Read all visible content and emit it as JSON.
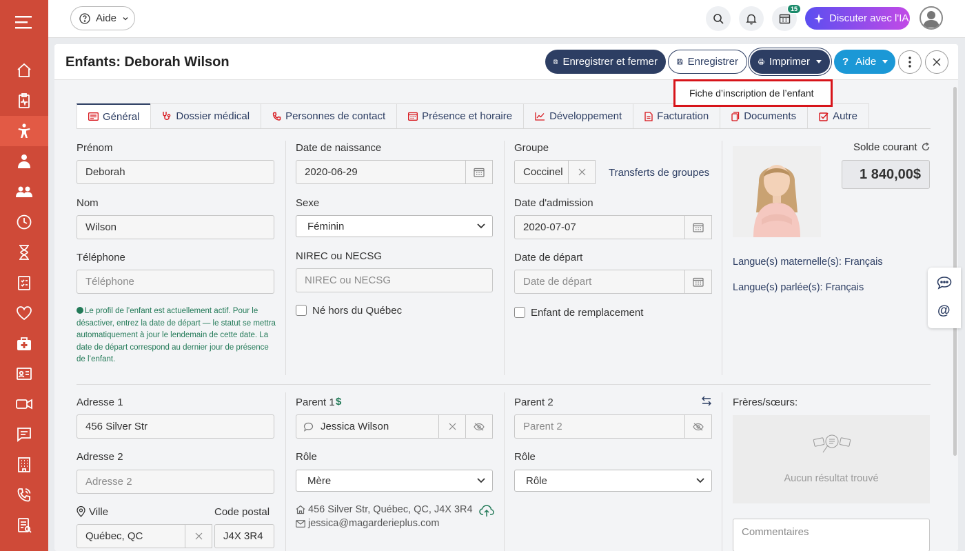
{
  "topbar": {
    "help_label": "Aide",
    "notifications_badge": "15",
    "ai_button_label": "Discuter avec l'IA"
  },
  "header": {
    "title": "Enfants: Deborah Wilson",
    "save_close_label": "Enregistrer et fermer",
    "save_label": "Enregistrer",
    "print_label": "Imprimer",
    "help_label": "Aide"
  },
  "print_menu": {
    "item_label": "Fiche d’inscription de l’enfant"
  },
  "tabs": [
    {
      "label": "Général",
      "icon": "id-card-icon"
    },
    {
      "label": "Dossier médical",
      "icon": "stethoscope-icon"
    },
    {
      "label": "Personnes de contact",
      "icon": "phone-icon"
    },
    {
      "label": "Présence et horaire",
      "icon": "calendar-icon"
    },
    {
      "label": "Développement",
      "icon": "chart-line-icon"
    },
    {
      "label": "Facturation",
      "icon": "invoice-icon"
    },
    {
      "label": "Documents",
      "icon": "document-icon"
    },
    {
      "label": "Autre",
      "icon": "checkbox-icon"
    }
  ],
  "identity": {
    "first_name_label": "Prénom",
    "first_name_value": "Deborah",
    "last_name_label": "Nom",
    "last_name_value": "Wilson",
    "phone_label": "Téléphone",
    "phone_placeholder": "Téléphone",
    "status_note": "Le profil de l’enfant est actuellement actif. Pour le désactiver, entrez la date de départ — le statut se mettra automatiquement à jour le lendemain de cette date. La date de départ correspond au dernier jour de présence de l’enfant."
  },
  "birth": {
    "dob_label": "Date de naissance",
    "dob_value": "2020-06-29",
    "sex_label": "Sexe",
    "sex_value": "Féminin",
    "nirec_label": "NIREC ou NECSG",
    "nirec_placeholder": "NIREC ou NECSG",
    "born_outside_label": "Né hors du Québec"
  },
  "group": {
    "group_label": "Groupe",
    "group_value": "Coccinel",
    "transfers_link": "Transferts de groupes",
    "admission_label": "Date d'admission",
    "admission_value": "2020-07-07",
    "departure_label": "Date de départ",
    "departure_placeholder": "Date de départ",
    "replacement_label": "Enfant de remplacement"
  },
  "profile": {
    "balance_label": "Solde courant",
    "balance_value": "1 840,00$",
    "mother_tongue": "Langue(s) maternelle(s): Français",
    "spoken_language": "Langue(s) parlée(s): Français"
  },
  "address": {
    "address1_label": "Adresse 1",
    "address1_value": "456 Silver Str",
    "address2_label": "Adresse 2",
    "address2_placeholder": "Adresse 2",
    "city_label": "Ville",
    "city_value": "Québec, QC",
    "postal_label": "Code postal",
    "postal_value": "J4X 3R4"
  },
  "parent1": {
    "label": "Parent 1",
    "value": "Jessica Wilson",
    "role_label": "Rôle",
    "role_value": "Mère",
    "address": "456 Silver Str, Québec, QC, J4X 3R4",
    "email": "jessica@magarderieplus.com"
  },
  "parent2": {
    "label": "Parent 2",
    "placeholder": "Parent 2",
    "role_label": "Rôle",
    "role_value": "Rôle"
  },
  "siblings": {
    "label": "Frères/sœurs:",
    "empty_text": "Aucun résultat trouvé",
    "comments_placeholder": "Commentaires"
  },
  "sidebar": {
    "items": [
      "menu-icon",
      "home-icon",
      "clipboard-health-icon",
      "child-icon",
      "staff-icon",
      "group-icon",
      "clock-icon",
      "hourglass-icon",
      "checklist-icon",
      "heart-icon",
      "first-aid-icon",
      "id-card-icon",
      "video-icon",
      "message-icon",
      "building-icon",
      "phone-icon",
      "report-icon"
    ]
  },
  "colors": {
    "sidebar": "#cf4a38",
    "primary_dark": "#2d3e63",
    "help_blue": "#1b98d6",
    "note_green": "#237a58",
    "highlight_red": "#d7141a"
  }
}
